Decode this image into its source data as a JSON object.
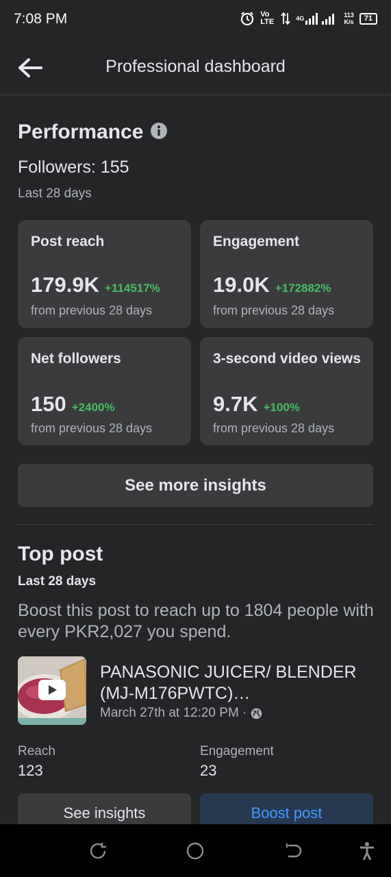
{
  "status_bar": {
    "time": "7:08 PM",
    "network_text": "Vo LTE",
    "signal_text": "4G",
    "speed_value": "113",
    "speed_unit": "K/s",
    "battery": "71"
  },
  "header": {
    "title": "Professional dashboard",
    "back_icon": "arrow-left-icon"
  },
  "performance": {
    "title": "Performance",
    "info_icon": "info-icon",
    "followers_text": "Followers: 155",
    "period": "Last 28 days",
    "cards": [
      {
        "label": "Post reach",
        "value": "179.9K",
        "delta": "+114517%",
        "from": "from previous 28 days"
      },
      {
        "label": "Engagement",
        "value": "19.0K",
        "delta": "+172882%",
        "from": "from previous 28 days"
      },
      {
        "label": "Net followers",
        "value": "150",
        "delta": "+2400%",
        "from": "from previous 28 days"
      },
      {
        "label": "3-second video views",
        "value": "9.7K",
        "delta": "+100%",
        "from": "from previous 28 days"
      }
    ],
    "see_more_label": "See more insights"
  },
  "top_post": {
    "title": "Top post",
    "period": "Last 28 days",
    "boost_text": "Boost this post to reach up to 1804 people with every PKR2,027 you spend.",
    "post_title": "PANASONIC JUICER/ BLENDER (MJ-M176PWTC)…",
    "post_date": "March 27th at 12:20 PM ·",
    "audience_icon": "globe-icon",
    "reach_label": "Reach",
    "reach_value": "123",
    "engagement_label": "Engagement",
    "engagement_value": "23",
    "see_insights_label": "See insights",
    "boost_label": "Boost post"
  },
  "colors": {
    "background": "#242527",
    "card": "#3a3b3c",
    "positive": "#45bd62",
    "boost_bg": "#263951",
    "boost_text": "#4599ff"
  }
}
